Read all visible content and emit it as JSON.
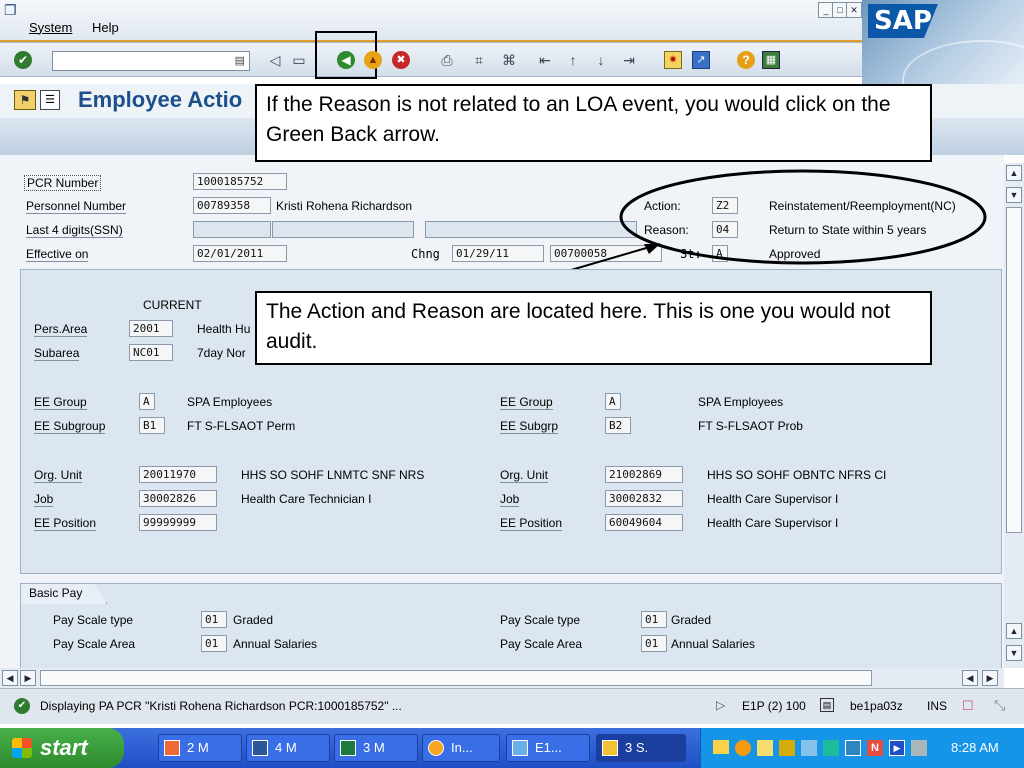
{
  "menubar": {
    "system": "System",
    "help": "Help"
  },
  "colors": {
    "accent": "#1d4f8a",
    "taskbar": "#2a5cd8",
    "start": "#3a9b3c"
  },
  "toolbar": {
    "command_value": "",
    "icons": [
      "enter-icon",
      "save-icon",
      "back-icon",
      "exit-icon",
      "cancel-icon",
      "print-icon",
      "find-icon",
      "find-next-icon",
      "first-page-icon",
      "prev-page-icon",
      "next-page-icon",
      "last-page-icon",
      "new-session-icon",
      "shortcut-icon",
      "help-icon",
      "layout-icon"
    ]
  },
  "title": {
    "text": "Employee Actio"
  },
  "callouts": {
    "back": "If the Reason is not related to an LOA event, you would click on the Green Back arrow.",
    "action": "The Action and Reason are located here.  This is one you would not audit."
  },
  "header": {
    "pcr_label": "PCR Number",
    "pcr_value": "1000185752",
    "pernr_label": "Personnel Number",
    "pernr_value": "00789358",
    "employee_name": "Kristi Rohena Richardson",
    "ssn_label": "Last 4 digits(SSN)",
    "effective_label": "Effective on",
    "effective_value": "02/01/2011",
    "chng_label": "Chng",
    "chng_date": "01/29/11",
    "chng_user": "00700058",
    "action_label": "Action:",
    "action_code": "Z2",
    "action_text": "Reinstatement/Reemployment(NC)",
    "reason_label": "Reason:",
    "reason_code": "04",
    "reason_text": "Return to State within 5 years",
    "status_label": "St:",
    "status_code": "A",
    "status_text": "Approved"
  },
  "org_panel": {
    "current_label": "CURRENT",
    "pers_area_label": "Pers.Area",
    "pers_area_value": "2001",
    "pers_area_text": "Health Hu",
    "subarea_label": "Subarea",
    "subarea_value": "NC01",
    "subarea_text": "7day Nor",
    "left": {
      "ee_group_label": "EE Group",
      "ee_group_value": "A",
      "ee_group_text": "SPA Employees",
      "ee_subgroup_label": "EE Subgroup",
      "ee_subgroup_value": "B1",
      "ee_subgroup_text": "FT S-FLSAOT Perm",
      "org_unit_label": "Org. Unit",
      "org_unit_value": "20011970",
      "org_unit_text": "HHS SO SOHF LNMTC SNF NRS",
      "job_label": "Job",
      "job_value": "30002826",
      "job_text": "Health Care Technician I",
      "position_label": "EE Position",
      "position_value": "99999999"
    },
    "right": {
      "ee_group_label": "EE Group",
      "ee_group_value": "A",
      "ee_group_text": "SPA Employees",
      "ee_subgroup_label": "EE Subgrp",
      "ee_subgroup_value": "B2",
      "ee_subgroup_text": "FT S-FLSAOT Prob",
      "org_unit_label": "Org. Unit",
      "org_unit_value": "21002869",
      "org_unit_text": "HHS SO SOHF OBNTC NFRS CI",
      "job_label": "Job",
      "job_value": "30002832",
      "job_text": "Health Care Supervisor I",
      "position_label": "EE Position",
      "position_value": "60049604",
      "position_text": "Health Care Supervisor I"
    }
  },
  "basic_pay": {
    "tab_label": "Basic Pay",
    "left": {
      "type_label": "Pay Scale type",
      "type_value": "01",
      "type_text": "Graded",
      "area_label": "Pay Scale Area",
      "area_value": "01",
      "area_text": "Annual Salaries"
    },
    "right": {
      "type_label": "Pay Scale type",
      "type_value": "01",
      "type_text": "Graded",
      "area_label": "Pay Scale Area",
      "area_value": "01",
      "area_text": "Annual Salaries"
    }
  },
  "status": {
    "message": "Displaying PA PCR \"Kristi Rohena Richardson PCR:1000185752\" ...",
    "system": "E1P (2) 100",
    "server": "be1pa03z",
    "mode": "INS"
  },
  "taskbar": {
    "start": "start",
    "tasks": [
      "2 M",
      "4 M",
      "3 M",
      "In...",
      "E1...",
      "3 S."
    ],
    "clock": "8:28 AM"
  }
}
